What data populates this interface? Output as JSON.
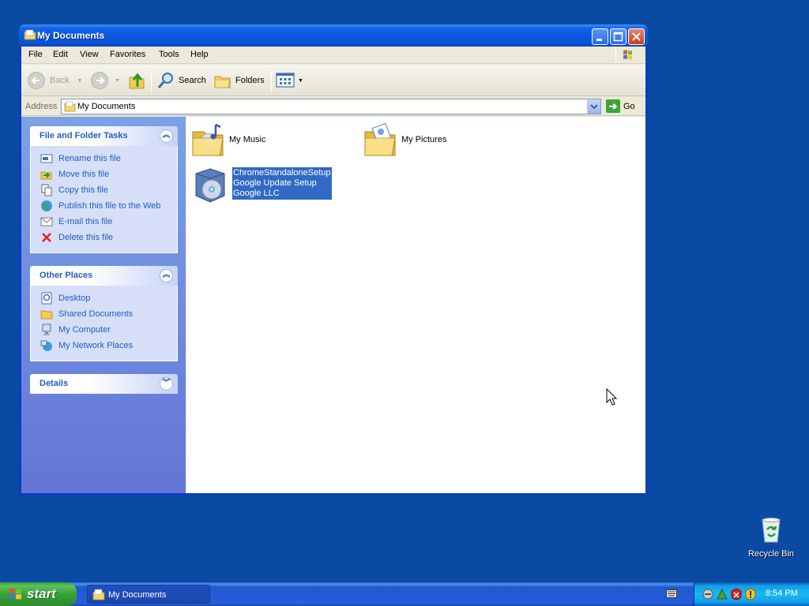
{
  "window": {
    "title": "My Documents",
    "menu": [
      "File",
      "Edit",
      "View",
      "Favorites",
      "Tools",
      "Help"
    ],
    "toolbar": {
      "back": "Back",
      "search": "Search",
      "folders": "Folders"
    },
    "address": {
      "label": "Address",
      "value": "My Documents",
      "go": "Go"
    }
  },
  "tasks": {
    "file_folder": {
      "title": "File and Folder Tasks",
      "items": [
        {
          "label": "Rename this file",
          "icon": "rename-icon"
        },
        {
          "label": "Move this file",
          "icon": "move-icon"
        },
        {
          "label": "Copy this file",
          "icon": "copy-icon"
        },
        {
          "label": "Publish this file to the Web",
          "icon": "globe-icon"
        },
        {
          "label": "E-mail this file",
          "icon": "email-icon"
        },
        {
          "label": "Delete this file",
          "icon": "delete-icon"
        }
      ]
    },
    "other_places": {
      "title": "Other Places",
      "items": [
        {
          "label": "Desktop",
          "icon": "desktop-icon"
        },
        {
          "label": "Shared Documents",
          "icon": "folder-icon"
        },
        {
          "label": "My Computer",
          "icon": "computer-icon"
        },
        {
          "label": "My Network Places",
          "icon": "network-icon"
        }
      ]
    },
    "details": {
      "title": "Details"
    }
  },
  "files": [
    {
      "name": "My Music",
      "icon": "music-folder-icon"
    },
    {
      "name": "My Pictures",
      "icon": "pictures-folder-icon"
    },
    {
      "name": "ChromeStandaloneSetup",
      "line2": "Google Update Setup",
      "line3": "Google LLC",
      "icon": "installer-icon",
      "selected": true
    }
  ],
  "desktop": {
    "recycle_bin": "Recycle Bin"
  },
  "taskbar": {
    "start": "start",
    "task_button": "My Documents",
    "clock": "8:54 PM"
  }
}
